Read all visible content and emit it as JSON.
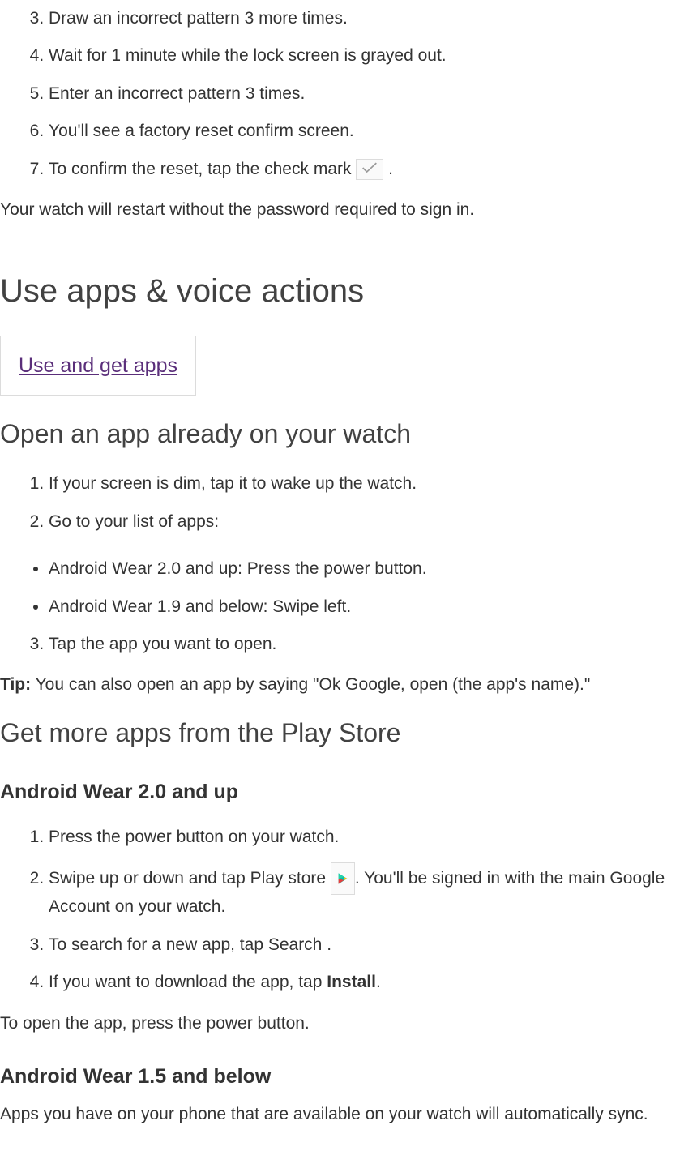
{
  "first_list": {
    "items": [
      {
        "n": "3",
        "t": "Draw an incorrect pattern 3 more times."
      },
      {
        "n": "4",
        "t": "Wait for 1 minute while the lock screen is grayed out."
      },
      {
        "n": "5",
        "t": "Enter an incorrect pattern 3 times."
      },
      {
        "n": "6",
        "t": "You'll see a factory reset confirm screen."
      },
      {
        "n": "7",
        "prefix": "To confirm the reset, tap the check mark ",
        "suffix": ".",
        "has_check_icon": true
      }
    ]
  },
  "after_first_list": "Your watch will restart without the password required to sign in.",
  "h1": "Use apps & voice actions",
  "box_link": "Use and get apps",
  "h2_open": "Open an app already on your watch",
  "open_list": {
    "items": [
      {
        "n": "1",
        "t": "If your screen is dim, tap it to wake up the watch."
      },
      {
        "n": "2",
        "t": "Go to your list of apps:"
      }
    ],
    "bullets": [
      "Android Wear 2.0 and up: Press the power button.",
      "Android Wear 1.9 and below: Swipe left."
    ],
    "items_after": [
      {
        "n": "3",
        "t": "Tap the app you want to open."
      }
    ]
  },
  "tip_prefix": "Tip:",
  "tip_body": " You can also open an app by saying \"Ok Google, open (the app's name).\"",
  "h2_get": "Get more apps from the Play Store",
  "h3_20": "Android Wear 2.0 and up",
  "get20_list": {
    "items": [
      {
        "n": "1",
        "t": "Press the power button on your watch."
      },
      {
        "n": "2",
        "prefix": "Swipe up or down and tap Play store ",
        "suffix": ". You'll be signed in with the main Google Account on your watch.",
        "has_play_icon": true
      },
      {
        "n": "3",
        "prefix": "To search for a new app, tap Search ",
        "suffix": "      ."
      },
      {
        "n": "4",
        "prefix": "If you want to download the app, tap ",
        "bold": "Install",
        "suffix": "."
      }
    ]
  },
  "after_get20": "To open the app, press the power button.",
  "h3_15": "Android Wear 1.5 and below",
  "after_h3_15": "Apps you have on your phone that are available on your watch will automatically sync."
}
